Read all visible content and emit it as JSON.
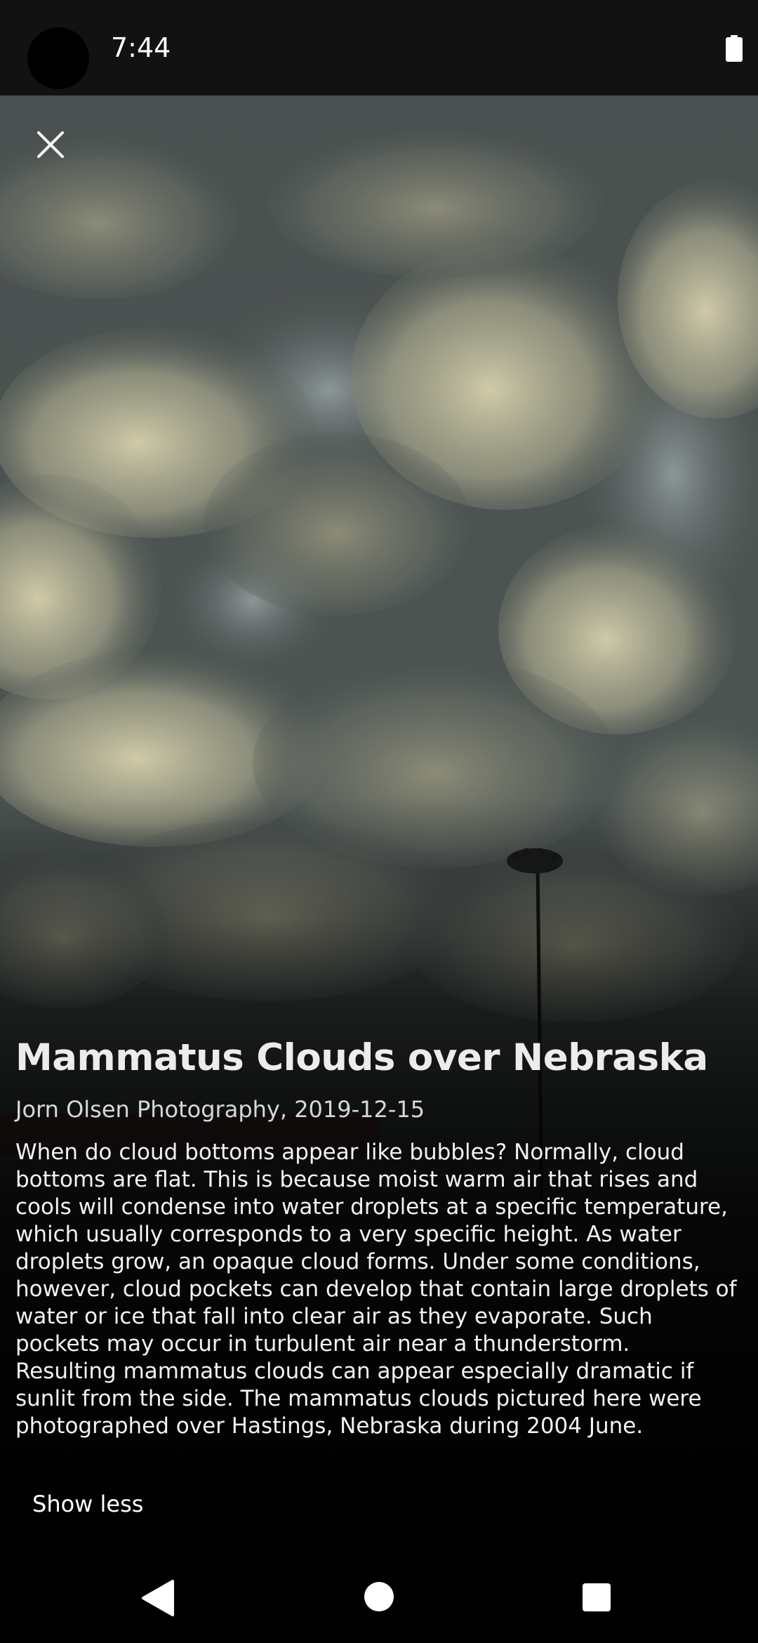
{
  "status_bar": {
    "time": "7:44",
    "icons": [
      "camera-cutout",
      "battery-icon"
    ]
  },
  "toolbar": {
    "close_icon": "close-icon"
  },
  "photo": {
    "subject": "mammatus-clouds-photo"
  },
  "article": {
    "title": "Mammatus Clouds over Nebraska",
    "credit": "Jorn Olsen Photography, 2019-12-15",
    "description_lines": [
      "When do cloud bottoms appear like bubbles? Normally, cloud",
      "bottoms are flat. This is because moist warm air that rises and",
      "cools will condense into water droplets at a specific temperature,",
      "which usually corresponds to a very specific height.  As water",
      "droplets grow, an opaque cloud forms.  Under some conditions,",
      "however, cloud pockets can develop that contain large droplets of",
      "water or ice that fall into clear air as they evaporate.  Such",
      "pockets may occur in turbulent air near a thunderstorm.",
      "Resulting mammatus clouds can appear especially dramatic if",
      "sunlit from the side.  The mammatus clouds pictured here were",
      "photographed over Hastings, Nebraska during 2004 June."
    ],
    "show_less_label": "Show less"
  },
  "nav_bar": {
    "icons": [
      "back-icon",
      "home-icon",
      "recents-icon"
    ]
  },
  "colors": {
    "status_bar_bg": "#121212",
    "cloud_highlight": "#cfc9a6",
    "cloud_shadow": "#3a4242",
    "text": "#ffffff"
  }
}
